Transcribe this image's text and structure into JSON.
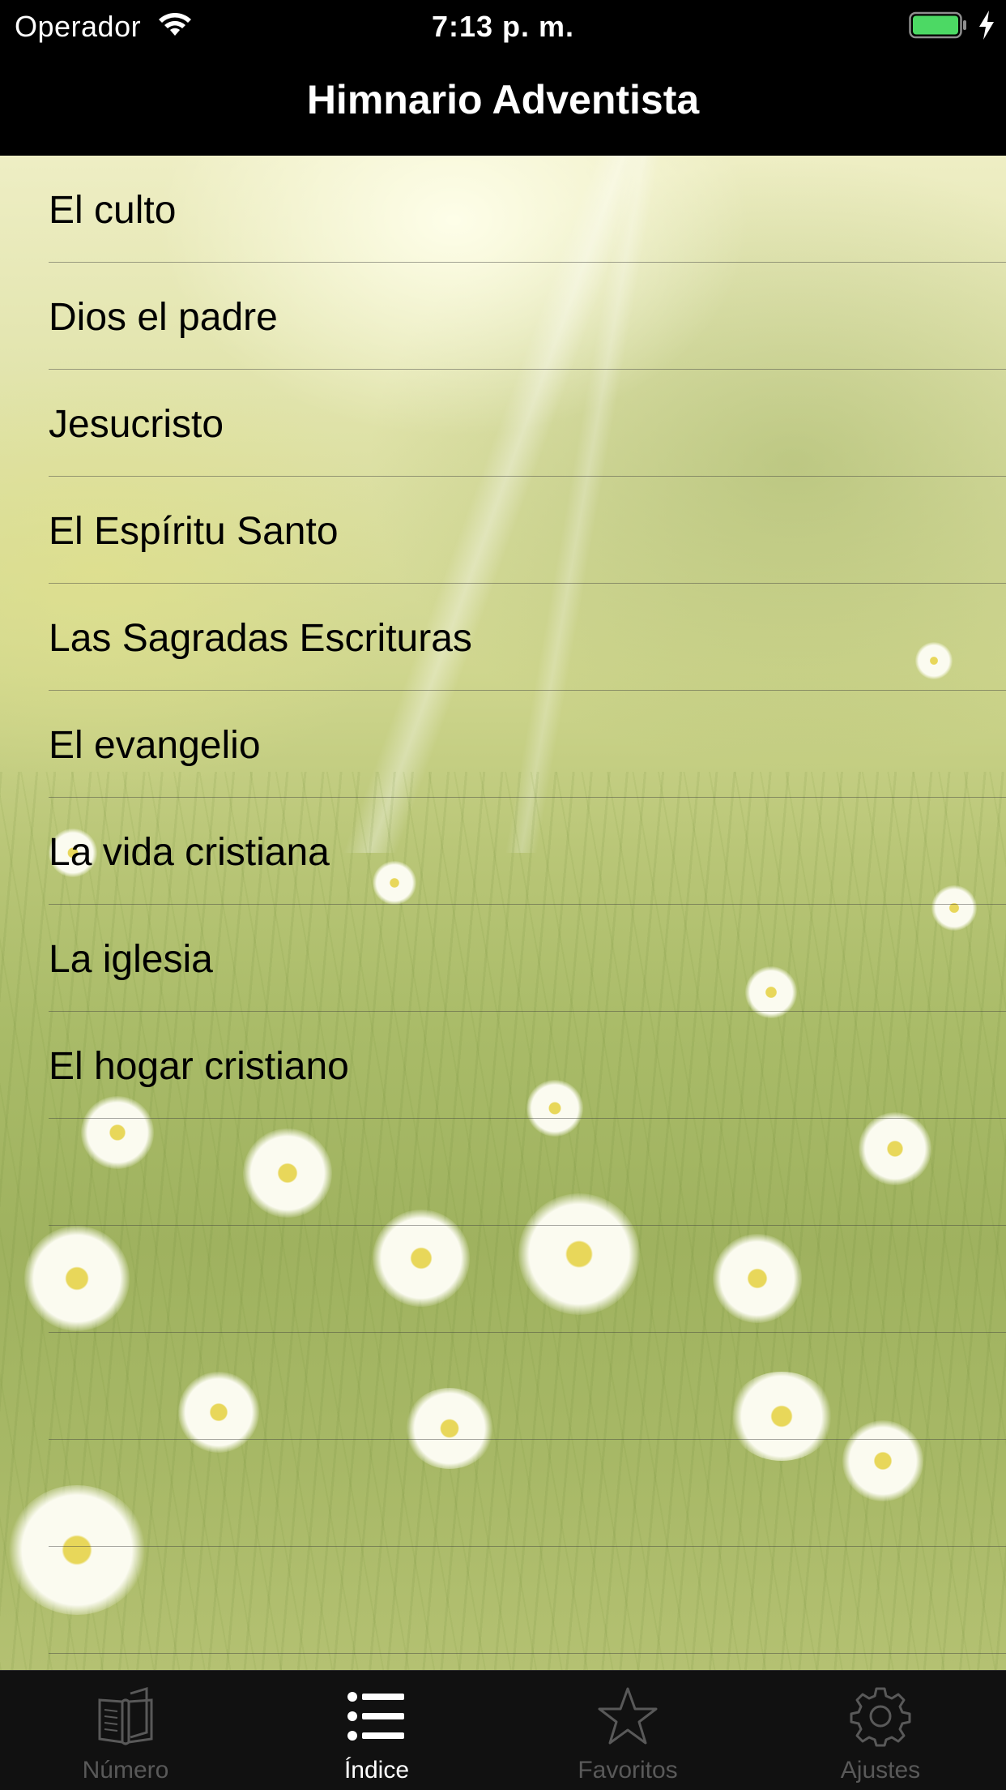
{
  "status_bar": {
    "carrier": "Operador",
    "time": "7:13 p. m.",
    "battery_color": "#4cd964"
  },
  "nav": {
    "title": "Himnario Adventista"
  },
  "index_list": {
    "items": [
      {
        "label": "El culto"
      },
      {
        "label": "Dios el padre"
      },
      {
        "label": "Jesucristo"
      },
      {
        "label": "El Espíritu Santo"
      },
      {
        "label": "Las Sagradas Escrituras"
      },
      {
        "label": "El evangelio"
      },
      {
        "label": "La vida cristiana"
      },
      {
        "label": "La iglesia"
      },
      {
        "label": "El hogar cristiano"
      }
    ]
  },
  "tab_bar": {
    "tabs": [
      {
        "label": "Número",
        "icon": "book-icon",
        "active": false
      },
      {
        "label": "Índice",
        "icon": "list-icon",
        "active": true
      },
      {
        "label": "Favoritos",
        "icon": "star-icon",
        "active": false
      },
      {
        "label": "Ajustes",
        "icon": "gear-icon",
        "active": false
      }
    ],
    "active_color": "#ffffff",
    "inactive_color": "#595959"
  }
}
